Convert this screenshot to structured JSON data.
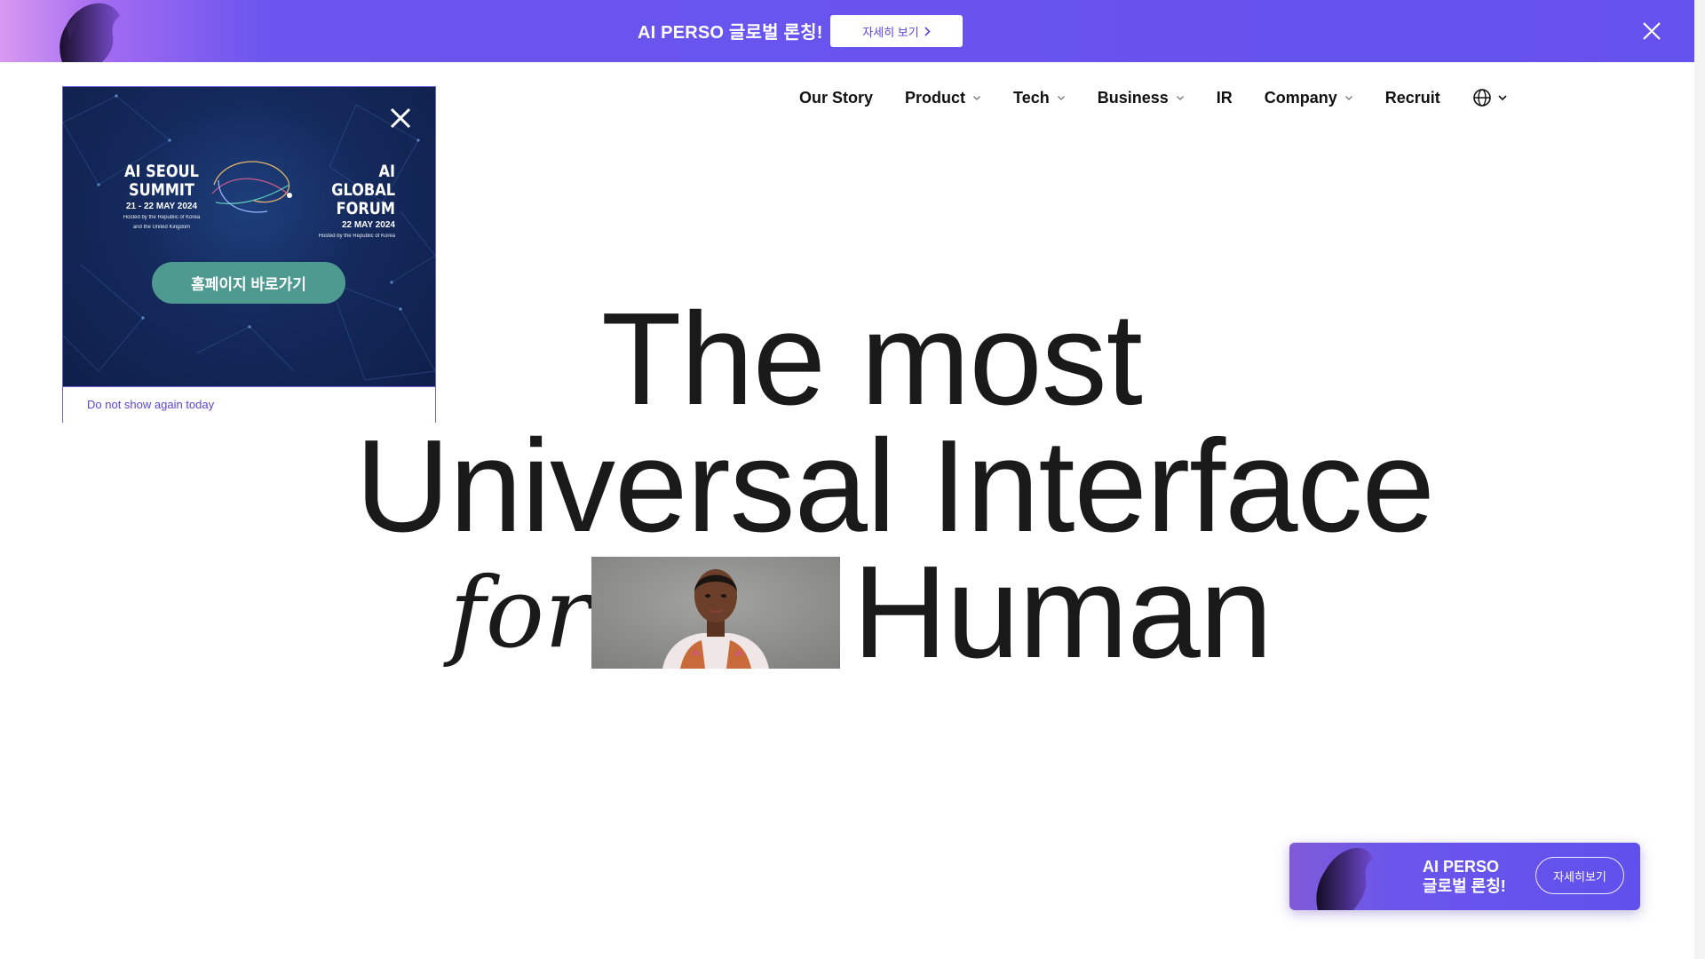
{
  "top_banner": {
    "text": "AI PERSO 글로벌 론칭!",
    "button_label": "자세히 보기",
    "close_icon": "close-icon"
  },
  "nav": {
    "items": [
      {
        "label": "Our Story",
        "dropdown": false
      },
      {
        "label": "Product",
        "dropdown": true
      },
      {
        "label": "Tech",
        "dropdown": true
      },
      {
        "label": "Business",
        "dropdown": true
      },
      {
        "label": "IR",
        "dropdown": false
      },
      {
        "label": "Company",
        "dropdown": true
      },
      {
        "label": "Recruit",
        "dropdown": false
      }
    ],
    "language_icon": "globe-icon"
  },
  "popup": {
    "left_event": {
      "title_line1": "AI SEOUL",
      "title_line2": "SUMMIT",
      "date": "21 - 22 MAY 2024",
      "host_line1": "Hosted by the Republic of Korea",
      "host_line2": "and the United Kingdom"
    },
    "right_event": {
      "title_line1": "AI GLOBAL",
      "title_line2": "FORUM",
      "date": "22 MAY 2024",
      "host_line1": "Hosted by the Republic of Korea"
    },
    "cta_label": "홈페이지 바로가기",
    "footer_label": "Do not show again today"
  },
  "hero": {
    "line1": "The most",
    "line2": "Universal Interface",
    "for_word": "for",
    "line3": "Human"
  },
  "floating_card": {
    "line1": "AI PERSO",
    "line2": "글로벌 론칭!",
    "button_label": "자세히보기"
  },
  "colors": {
    "brand_purple": "#6551ee",
    "cta_teal": "#4e9a91",
    "popup_navy": "#14295c"
  }
}
